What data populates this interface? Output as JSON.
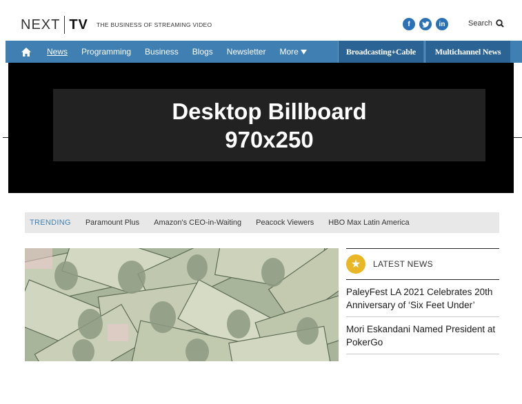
{
  "header": {
    "logo_next": "NEXT",
    "logo_tv": "TV",
    "tagline": "THE BUSINESS OF STREAMING VIDEO",
    "social": [
      {
        "icon": "facebook-icon",
        "glyph": "f"
      },
      {
        "icon": "twitter-icon",
        "glyph": "t"
      },
      {
        "icon": "linkedin-icon",
        "glyph": "in"
      }
    ],
    "search_label": "Search"
  },
  "nav": {
    "home_icon": "home-icon",
    "items": [
      {
        "label": "News",
        "active": true
      },
      {
        "label": "Programming"
      },
      {
        "label": "Business"
      },
      {
        "label": "Blogs"
      },
      {
        "label": "Newsletter"
      }
    ],
    "more_label": "More",
    "brands": [
      "Broadcasting+Cable",
      "Multichannel News"
    ],
    "accent": "#3f7fb1"
  },
  "billboard": {
    "line1": "Desktop Billboard",
    "line2": "970x250"
  },
  "trending": {
    "label": "TRENDING",
    "items": [
      "Paramount Plus",
      "Amazon's CEO-in-Waiting",
      "Peacock Viewers",
      "HBO Max Latin America"
    ]
  },
  "latest": {
    "label": "LATEST NEWS",
    "icon": "star-icon",
    "items": [
      "PaleyFest LA 2021 Celebrates 20th Anniversary of ‘Six Feet Under’",
      "Mori Eskandani Named President at PokerGo"
    ]
  }
}
